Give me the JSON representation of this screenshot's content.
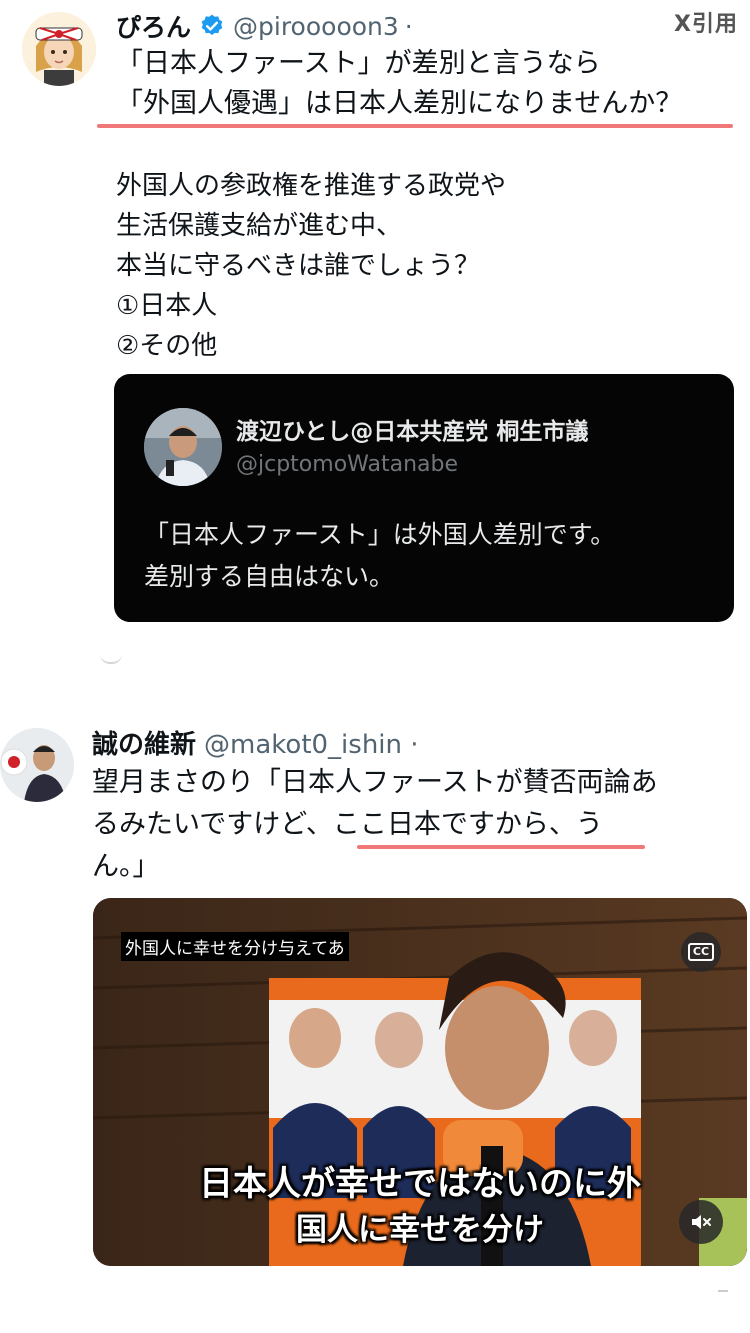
{
  "page_label": "X引用",
  "tweet1": {
    "name": "ぴろん",
    "handle": "@pirooooon3",
    "dot": "·",
    "headline": [
      "「日本人ファースト」が差別と言うなら",
      "「外国人優遇」は日本人差別になりませんか？"
    ],
    "body": [
      "外国人の参政権を推進する政党や",
      "生活保護支給が進む中、",
      "本当に守るべきは誰でしょう？",
      "①日本人",
      "②その他"
    ],
    "quote": {
      "name": "渡辺ひとし@日本共産党 桐生市議",
      "handle": "@jcptomoWatanabe",
      "text": [
        "「日本人ファースト」は外国人差別です。",
        "差別する自由はない。"
      ]
    }
  },
  "tweet2": {
    "name": "誠の維新",
    "handle": "@makot0_ishin ·",
    "text": [
      "望月まさのり「日本人ファーストが賛否両論あ",
      "るみたいですけど、ここ日本ですから、う",
      "ん。」"
    ],
    "video": {
      "caption_top": "外国人に幸せを分け与えてあ",
      "subtitle": [
        "日本人が幸せではないのに外",
        "国人に幸せを分け"
      ],
      "cc_label": "CC"
    }
  },
  "colors": {
    "highlight": "#f07878",
    "verified": "#1d9bf0",
    "quote_bg": "#050505"
  }
}
